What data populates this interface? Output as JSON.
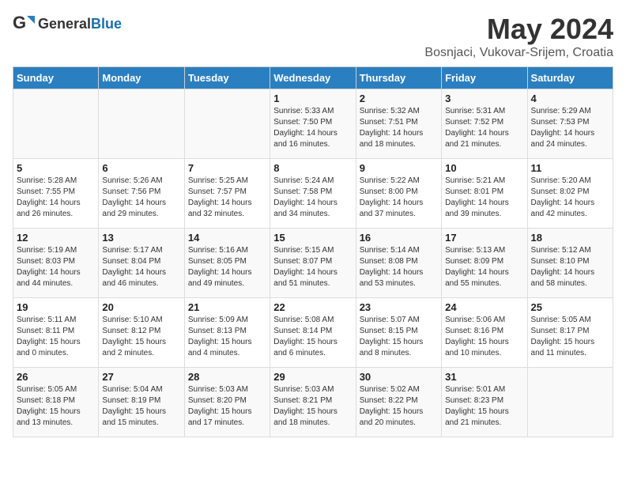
{
  "header": {
    "logo_general": "General",
    "logo_blue": "Blue",
    "title": "May 2024",
    "subtitle": "Bosnjaci, Vukovar-Srijem, Croatia"
  },
  "days_of_week": [
    "Sunday",
    "Monday",
    "Tuesday",
    "Wednesday",
    "Thursday",
    "Friday",
    "Saturday"
  ],
  "weeks": [
    [
      {
        "day": "",
        "info": ""
      },
      {
        "day": "",
        "info": ""
      },
      {
        "day": "",
        "info": ""
      },
      {
        "day": "1",
        "info": "Sunrise: 5:33 AM\nSunset: 7:50 PM\nDaylight: 14 hours\nand 16 minutes."
      },
      {
        "day": "2",
        "info": "Sunrise: 5:32 AM\nSunset: 7:51 PM\nDaylight: 14 hours\nand 18 minutes."
      },
      {
        "day": "3",
        "info": "Sunrise: 5:31 AM\nSunset: 7:52 PM\nDaylight: 14 hours\nand 21 minutes."
      },
      {
        "day": "4",
        "info": "Sunrise: 5:29 AM\nSunset: 7:53 PM\nDaylight: 14 hours\nand 24 minutes."
      }
    ],
    [
      {
        "day": "5",
        "info": "Sunrise: 5:28 AM\nSunset: 7:55 PM\nDaylight: 14 hours\nand 26 minutes."
      },
      {
        "day": "6",
        "info": "Sunrise: 5:26 AM\nSunset: 7:56 PM\nDaylight: 14 hours\nand 29 minutes."
      },
      {
        "day": "7",
        "info": "Sunrise: 5:25 AM\nSunset: 7:57 PM\nDaylight: 14 hours\nand 32 minutes."
      },
      {
        "day": "8",
        "info": "Sunrise: 5:24 AM\nSunset: 7:58 PM\nDaylight: 14 hours\nand 34 minutes."
      },
      {
        "day": "9",
        "info": "Sunrise: 5:22 AM\nSunset: 8:00 PM\nDaylight: 14 hours\nand 37 minutes."
      },
      {
        "day": "10",
        "info": "Sunrise: 5:21 AM\nSunset: 8:01 PM\nDaylight: 14 hours\nand 39 minutes."
      },
      {
        "day": "11",
        "info": "Sunrise: 5:20 AM\nSunset: 8:02 PM\nDaylight: 14 hours\nand 42 minutes."
      }
    ],
    [
      {
        "day": "12",
        "info": "Sunrise: 5:19 AM\nSunset: 8:03 PM\nDaylight: 14 hours\nand 44 minutes."
      },
      {
        "day": "13",
        "info": "Sunrise: 5:17 AM\nSunset: 8:04 PM\nDaylight: 14 hours\nand 46 minutes."
      },
      {
        "day": "14",
        "info": "Sunrise: 5:16 AM\nSunset: 8:05 PM\nDaylight: 14 hours\nand 49 minutes."
      },
      {
        "day": "15",
        "info": "Sunrise: 5:15 AM\nSunset: 8:07 PM\nDaylight: 14 hours\nand 51 minutes."
      },
      {
        "day": "16",
        "info": "Sunrise: 5:14 AM\nSunset: 8:08 PM\nDaylight: 14 hours\nand 53 minutes."
      },
      {
        "day": "17",
        "info": "Sunrise: 5:13 AM\nSunset: 8:09 PM\nDaylight: 14 hours\nand 55 minutes."
      },
      {
        "day": "18",
        "info": "Sunrise: 5:12 AM\nSunset: 8:10 PM\nDaylight: 14 hours\nand 58 minutes."
      }
    ],
    [
      {
        "day": "19",
        "info": "Sunrise: 5:11 AM\nSunset: 8:11 PM\nDaylight: 15 hours\nand 0 minutes."
      },
      {
        "day": "20",
        "info": "Sunrise: 5:10 AM\nSunset: 8:12 PM\nDaylight: 15 hours\nand 2 minutes."
      },
      {
        "day": "21",
        "info": "Sunrise: 5:09 AM\nSunset: 8:13 PM\nDaylight: 15 hours\nand 4 minutes."
      },
      {
        "day": "22",
        "info": "Sunrise: 5:08 AM\nSunset: 8:14 PM\nDaylight: 15 hours\nand 6 minutes."
      },
      {
        "day": "23",
        "info": "Sunrise: 5:07 AM\nSunset: 8:15 PM\nDaylight: 15 hours\nand 8 minutes."
      },
      {
        "day": "24",
        "info": "Sunrise: 5:06 AM\nSunset: 8:16 PM\nDaylight: 15 hours\nand 10 minutes."
      },
      {
        "day": "25",
        "info": "Sunrise: 5:05 AM\nSunset: 8:17 PM\nDaylight: 15 hours\nand 11 minutes."
      }
    ],
    [
      {
        "day": "26",
        "info": "Sunrise: 5:05 AM\nSunset: 8:18 PM\nDaylight: 15 hours\nand 13 minutes."
      },
      {
        "day": "27",
        "info": "Sunrise: 5:04 AM\nSunset: 8:19 PM\nDaylight: 15 hours\nand 15 minutes."
      },
      {
        "day": "28",
        "info": "Sunrise: 5:03 AM\nSunset: 8:20 PM\nDaylight: 15 hours\nand 17 minutes."
      },
      {
        "day": "29",
        "info": "Sunrise: 5:03 AM\nSunset: 8:21 PM\nDaylight: 15 hours\nand 18 minutes."
      },
      {
        "day": "30",
        "info": "Sunrise: 5:02 AM\nSunset: 8:22 PM\nDaylight: 15 hours\nand 20 minutes."
      },
      {
        "day": "31",
        "info": "Sunrise: 5:01 AM\nSunset: 8:23 PM\nDaylight: 15 hours\nand 21 minutes."
      },
      {
        "day": "",
        "info": ""
      }
    ]
  ]
}
